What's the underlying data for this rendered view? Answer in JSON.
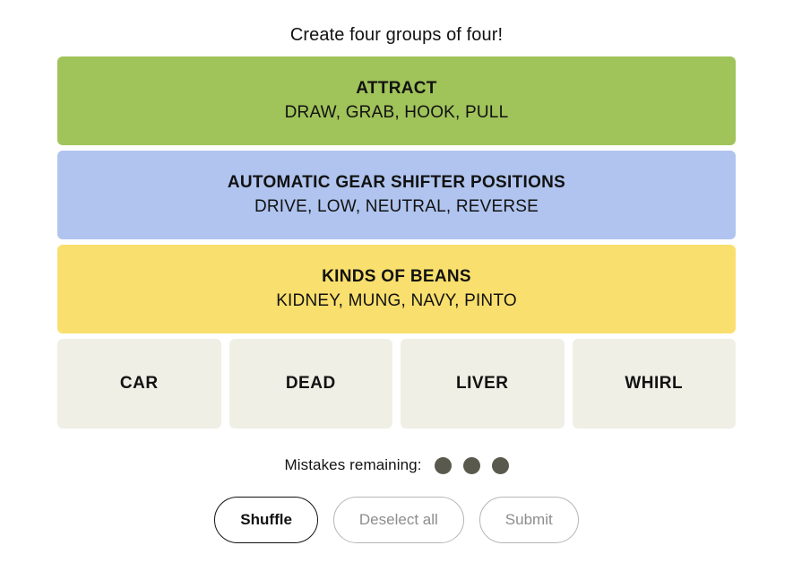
{
  "prompt": "Create four groups of four!",
  "solved_groups": [
    {
      "title": "ATTRACT",
      "members": "DRAW, GRAB, HOOK, PULL",
      "color": "#a0c35a",
      "difficulty": "green"
    },
    {
      "title": "AUTOMATIC GEAR SHIFTER POSITIONS",
      "members": "DRIVE, LOW, NEUTRAL, REVERSE",
      "color": "#b0c4ef",
      "difficulty": "blue"
    },
    {
      "title": "KINDS OF BEANS",
      "members": "KIDNEY, MUNG, NAVY, PINTO",
      "color": "#f9df6d",
      "difficulty": "yellow"
    }
  ],
  "tiles": [
    {
      "label": "CAR"
    },
    {
      "label": "DEAD"
    },
    {
      "label": "LIVER"
    },
    {
      "label": "WHIRL"
    }
  ],
  "mistakes": {
    "label": "Mistakes remaining:",
    "remaining": 3,
    "dot_color": "#5a594e"
  },
  "controls": {
    "shuffle": "Shuffle",
    "deselect_all": "Deselect all",
    "submit": "Submit"
  },
  "colors": {
    "tile_background": "#efefe6",
    "text": "#121212",
    "disabled_text": "#8d8d8d",
    "disabled_border": "#b6b6b6",
    "page_background": "#ffffff"
  }
}
